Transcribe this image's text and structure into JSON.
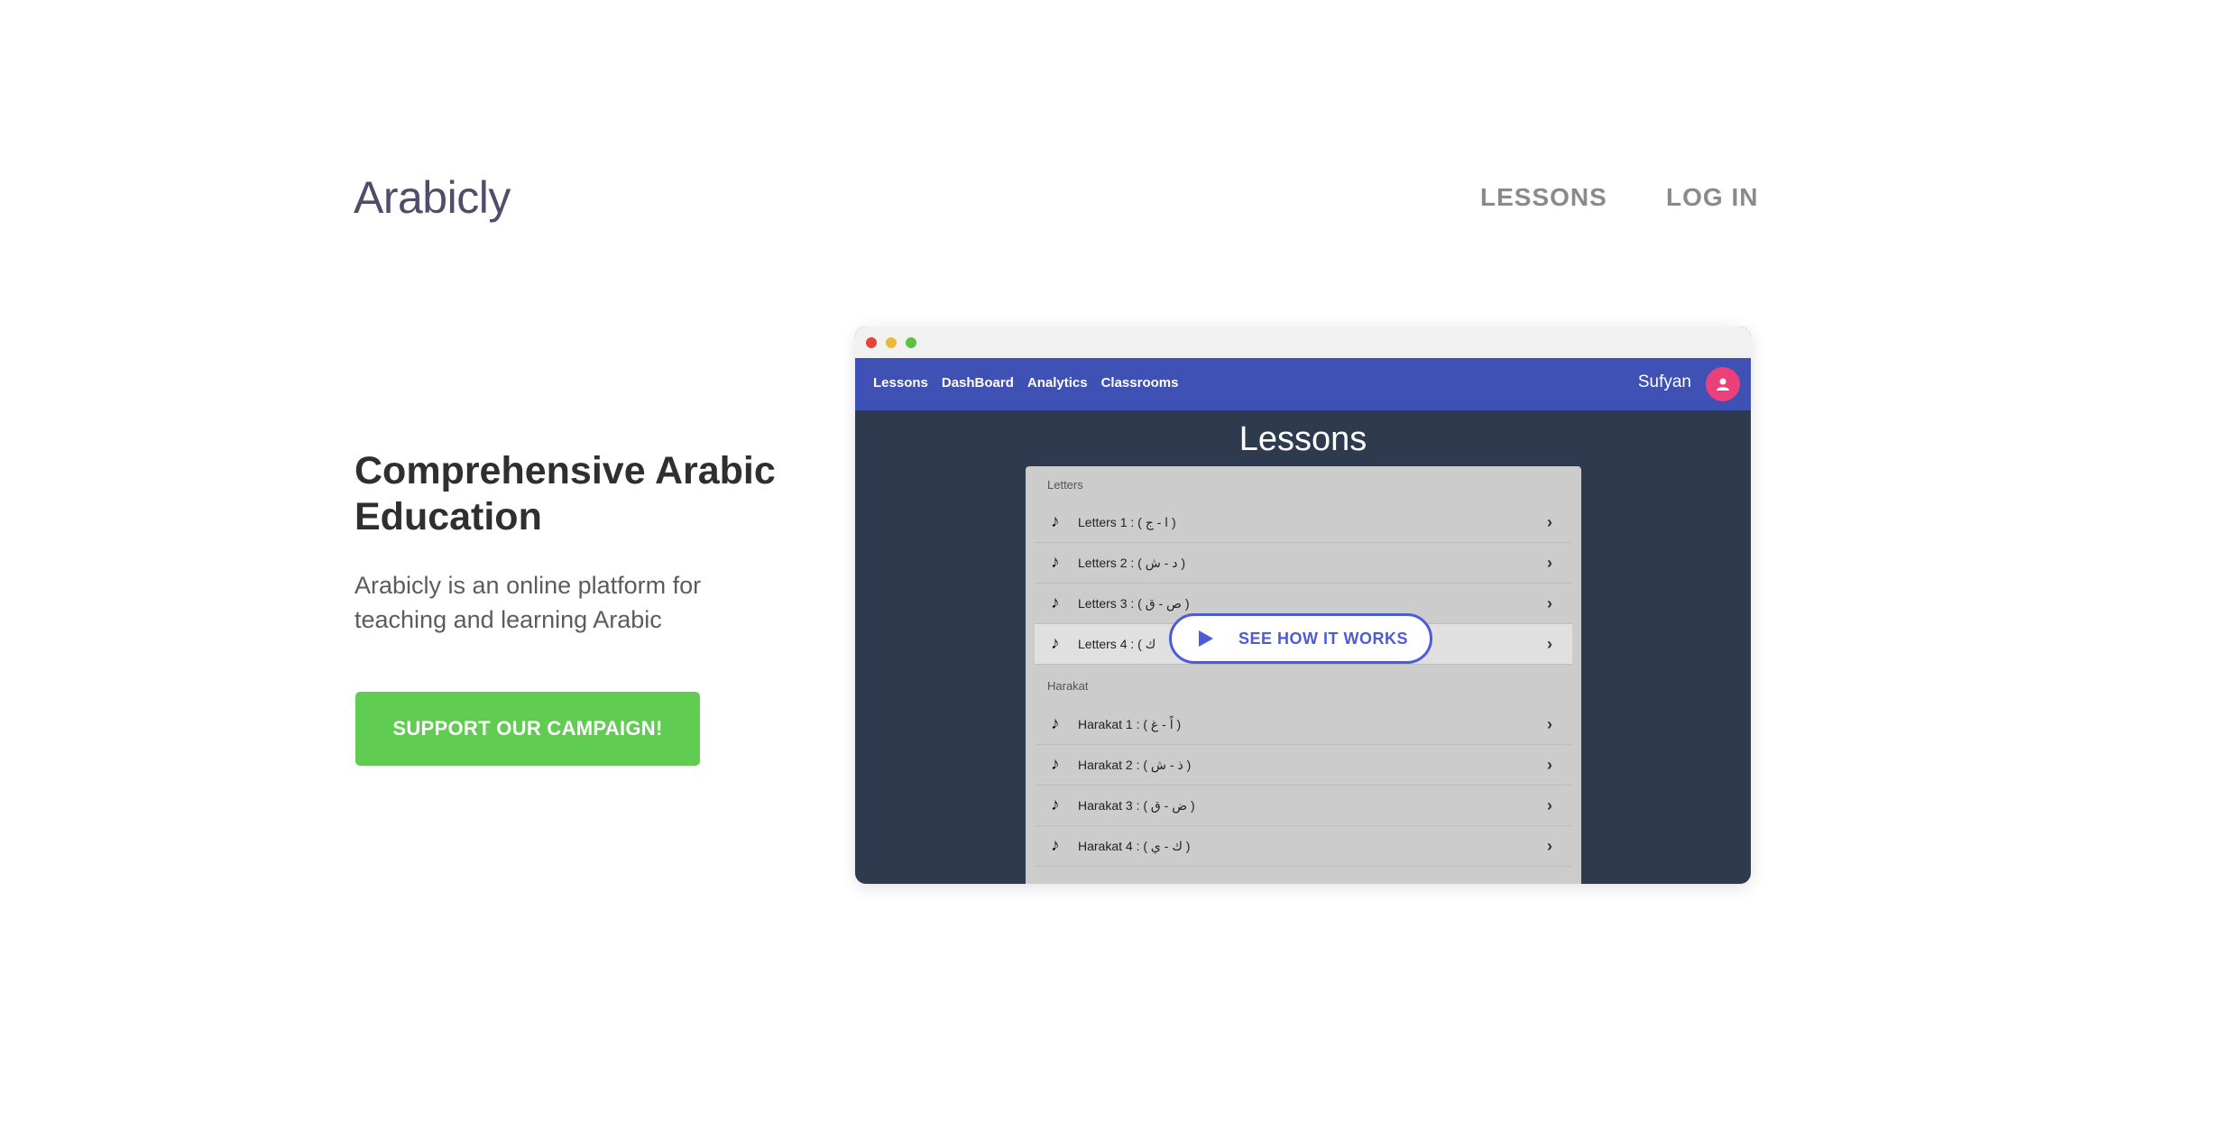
{
  "brand": {
    "logo": "Arabicly"
  },
  "nav": {
    "lessons": "LESSONS",
    "login": "LOG IN"
  },
  "hero": {
    "headline": "Comprehensive Arabic Education",
    "description": "Arabicly is an online platform for teaching and learning Arabic",
    "cta": "SUPPORT OUR CAMPAIGN!"
  },
  "mockup": {
    "nav_links": [
      "Lessons",
      "DashBoard",
      "Analytics",
      "Classrooms"
    ],
    "user": "Sufyan",
    "title": "Lessons",
    "sections": [
      {
        "label": "Letters",
        "rows": [
          "Letters 1 : ( ا - ج )",
          "Letters 2 : ( د - ش )",
          "Letters 3 : ( ص - ق )",
          "Letters 4 : ( ك"
        ]
      },
      {
        "label": "Harakat",
        "rows": [
          "Harakat 1 : ( اً - غ )",
          "Harakat 2 : ( ذ - ش )",
          "Harakat 3 : ( ض - ق )",
          "Harakat 4 : ( ك - ي )"
        ]
      }
    ],
    "play_button": "SEE HOW IT WORKS"
  },
  "colors": {
    "cta": "#61cc52",
    "mock_nav": "#3f51b5",
    "mock_bg": "#2e3b4f",
    "avatar": "#ec407a",
    "play": "#4c5bd8"
  }
}
